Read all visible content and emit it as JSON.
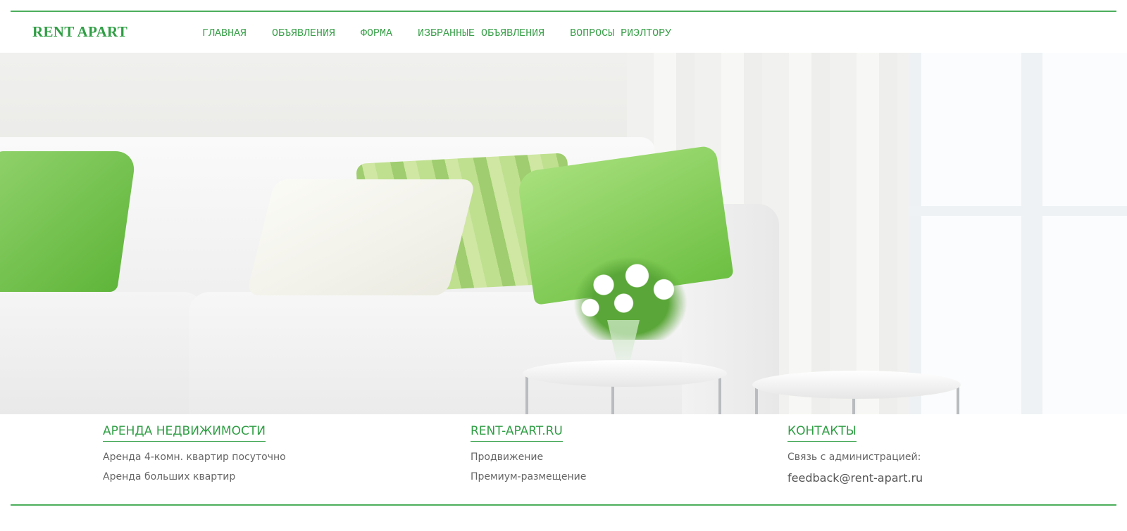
{
  "header": {
    "logo": "RENT APART",
    "nav": [
      {
        "label": "ГЛАВНАЯ"
      },
      {
        "label": "ОБЪЯВЛЕНИЯ"
      },
      {
        "label": "ФОРМА"
      },
      {
        "label": "ИЗБРАННЫЕ ОБЪЯВЛЕНИЯ"
      },
      {
        "label": "ВОПРОСЫ РИЭЛТОРУ"
      }
    ]
  },
  "footer": {
    "col1": {
      "title": "АРЕНДА НЕДВИЖИМОСТИ",
      "links": [
        "Аренда 4-комн. квартир посуточно",
        "Аренда больших квартир"
      ]
    },
    "col2": {
      "title": "RENT-APART.RU",
      "links": [
        "Продвижение",
        "Премиум-размещение"
      ]
    },
    "col3": {
      "title": "КОНТАКТЫ",
      "text": "Связь с администрацией:",
      "email": "feedback@rent-apart.ru"
    }
  },
  "colors": {
    "accent": "#2f9e44",
    "rule": "#4cae5c",
    "text_muted": "#666666"
  }
}
